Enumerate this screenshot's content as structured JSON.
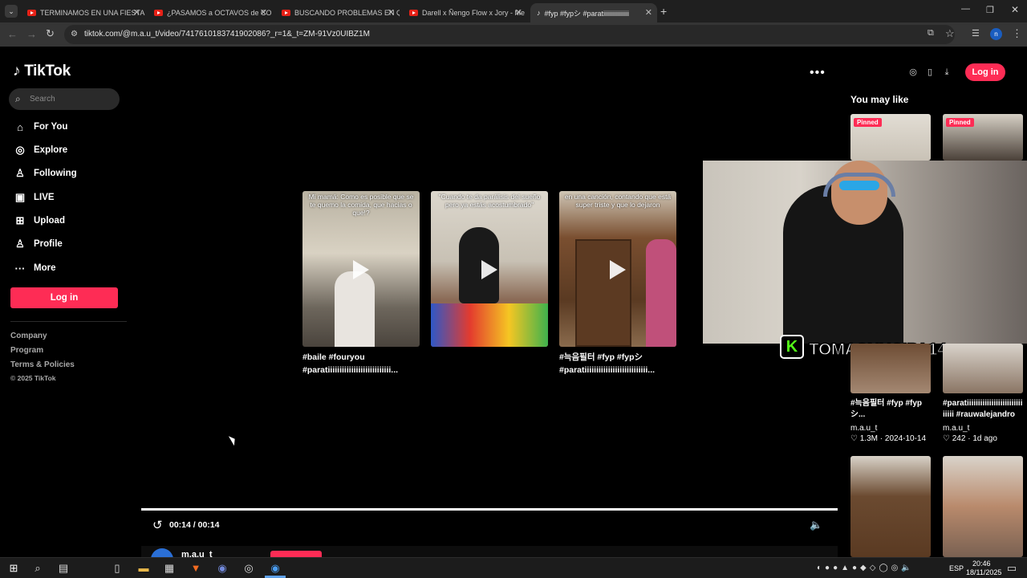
{
  "browser": {
    "tabs": [
      {
        "label": "TERMINAMOS EN UNA FIESTA",
        "active": false
      },
      {
        "label": "¿PASAMOS a OCTAVOS de COPA",
        "active": false
      },
      {
        "label": "BUSCANDO PROBLEMAS EN QU",
        "active": false
      },
      {
        "label": "Darell x Ñengo Flow x Jory - Me",
        "active": false
      },
      {
        "label": "#fyp #fypシ #paratiiiiiiiiiiiiiiii",
        "active": true
      }
    ],
    "url": "tiktok.com/@m.a.u_t/video/7417610183741902086?_r=1&_t=ZM-91Vz0UIBZ1M",
    "profile_initial": "n"
  },
  "tiktok": {
    "logo": "TikTok",
    "search_placeholder": "Search",
    "nav": [
      {
        "label": "For You",
        "icon": "home-icon",
        "glyph": "⌂"
      },
      {
        "label": "Explore",
        "icon": "compass-icon",
        "glyph": "◎"
      },
      {
        "label": "Following",
        "icon": "user-icon",
        "glyph": "♙"
      },
      {
        "label": "LIVE",
        "icon": "live-icon",
        "glyph": "▣"
      },
      {
        "label": "Upload",
        "icon": "upload-icon",
        "glyph": "⊞"
      },
      {
        "label": "Profile",
        "icon": "profile-icon",
        "glyph": "♙"
      },
      {
        "label": "More",
        "icon": "more-icon",
        "glyph": "···"
      }
    ],
    "login_label": "Log in",
    "footer": [
      "Company",
      "Program",
      "Terms & Policies"
    ],
    "copyright": "© 2025 TikTok"
  },
  "main": {
    "cards": [
      {
        "caption": "Mi mamá: Como es posible que se te quemo la comida, que hacias o que!?",
        "title_lines": [
          "#baile #fouryou",
          "#paratiiiiiiiiiiiiiiiiiiiiiiiiiii..."
        ]
      },
      {
        "caption": "\"Cuando te da parálisis del sueño pero ya estás acostumbrado\"",
        "title_lines": [
          "",
          ""
        ]
      },
      {
        "caption": "en una canción, contando que está super triste y que lo dejaron",
        "title_lines": [
          "#늑음필터 #fyp #fypシ",
          "#paratiiiiiiiiiiiiiiiiiiiiiiiiiii..."
        ]
      }
    ],
    "time": "00:14 / 00:14",
    "author": "m.a.u_t"
  },
  "right": {
    "heading": "You may like",
    "pinned_label": "Pinned",
    "overlay_name": "TOMASNUCIPA14",
    "overlay_badge": "K",
    "items": [
      {
        "title": "#늑음필터 #fyp #fyp シ...",
        "author": "m.a.u_t",
        "likes": "1.3M",
        "date": "2024-10-14"
      },
      {
        "title": "#paratiiiiiiiiiiiiiiiiiiiiiiiii iiiii #rauwalejandro",
        "author": "m.a.u_t",
        "likes": "242",
        "date": "1d ago"
      }
    ]
  },
  "taskbar": {
    "lang": "ESP",
    "time": "20:46",
    "date": "18/11/2025"
  }
}
